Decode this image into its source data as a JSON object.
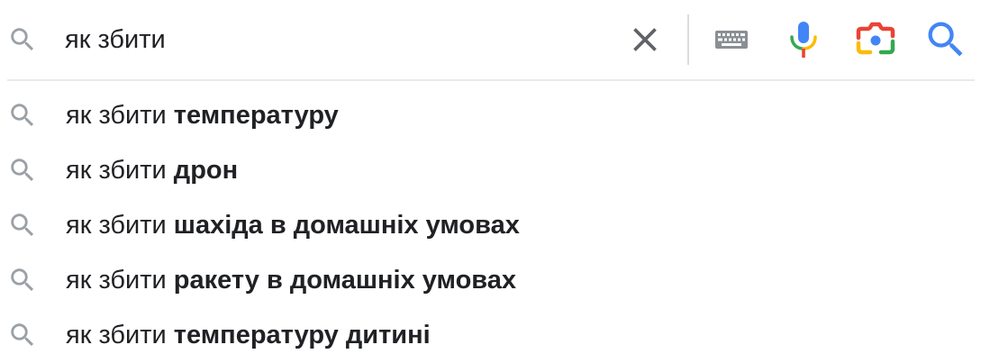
{
  "search": {
    "query": "як збити"
  },
  "suggestions": [
    {
      "prefix": "як збити ",
      "completion": "температуру"
    },
    {
      "prefix": "як збити ",
      "completion": "дрон"
    },
    {
      "prefix": "як збити ",
      "completion": "шахіда в домашніх умовах"
    },
    {
      "prefix": "як збити ",
      "completion": "ракету в домашніх умовах"
    },
    {
      "prefix": "як збити ",
      "completion": "температуру дитині"
    }
  ],
  "icons": {
    "search_leading": "search-icon",
    "clear": "close-icon",
    "keyboard": "keyboard-icon",
    "voice": "microphone-icon",
    "lens": "camera-lens-icon",
    "submit": "search-icon",
    "suggestion": "search-icon"
  },
  "colors": {
    "text": "#202124",
    "icon_gray": "#9aa0a6",
    "clear_gray": "#5f6368",
    "google_blue": "#4285f4",
    "google_red": "#ea4335",
    "google_yellow": "#fbbc04",
    "google_green": "#34a853",
    "divider": "#dadce0"
  }
}
